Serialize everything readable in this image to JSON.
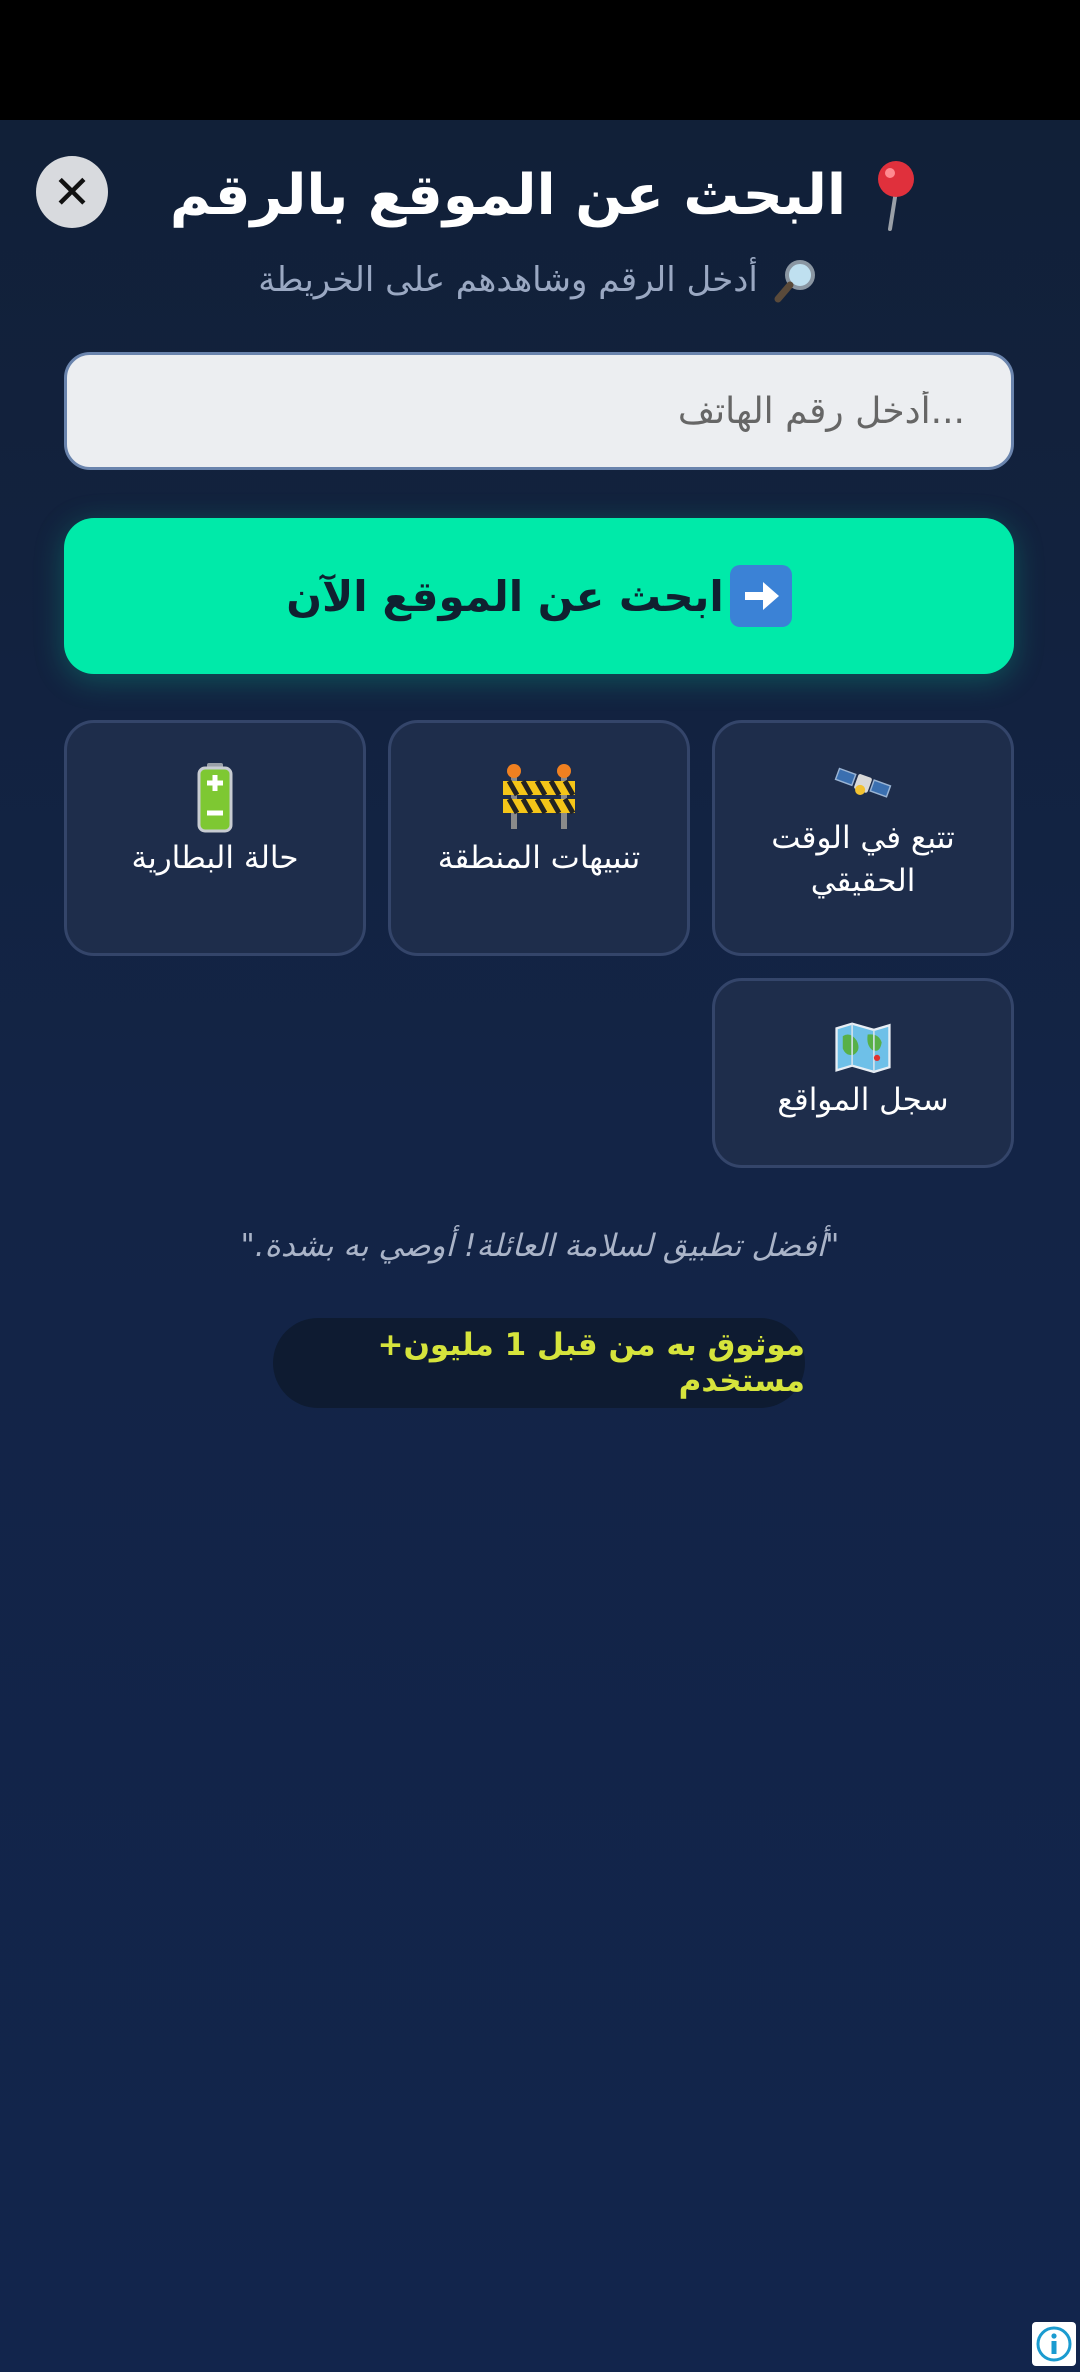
{
  "header": {
    "title": "البحث عن الموقع بالرقم",
    "subtitle": "أدخل الرقم وشاهدهم على الخريطة",
    "close_label": "✕"
  },
  "search": {
    "placeholder": "...أدخل رقم الهاتف",
    "value": ""
  },
  "primary_button": {
    "label": "ابحث عن الموقع الآن"
  },
  "features": [
    {
      "label": "تتبع في الوقت الحقيقي",
      "icon": "satellite-icon"
    },
    {
      "label": "تنبيهات المنطقة",
      "icon": "barrier-icon"
    },
    {
      "label": "حالة البطارية",
      "icon": "battery-icon"
    },
    {
      "label": "سجل المواقع",
      "icon": "map-icon"
    }
  ],
  "testimonial": "\"أفضل تطبيق لسلامة العائلة! أوصي به بشدة.\"",
  "trust_badge": "موثوق به من قبل 1 مليون+ مستخدم",
  "colors": {
    "accent": "#00eaa9",
    "background": "#132446",
    "card": "#1e2d4b",
    "badge_text": "#d6e43c"
  }
}
